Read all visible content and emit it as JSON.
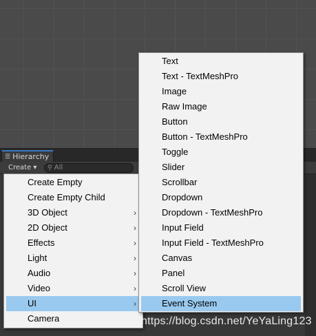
{
  "hierarchy": {
    "tab_label": "Hierarchy",
    "create_label": "Create ▾",
    "search_placeholder": "All"
  },
  "create_menu": {
    "items": [
      {
        "label": "Create Empty",
        "submenu": false
      },
      {
        "label": "Create Empty Child",
        "submenu": false
      },
      {
        "label": "3D Object",
        "submenu": true
      },
      {
        "label": "2D Object",
        "submenu": true
      },
      {
        "label": "Effects",
        "submenu": true
      },
      {
        "label": "Light",
        "submenu": true
      },
      {
        "label": "Audio",
        "submenu": true
      },
      {
        "label": "Video",
        "submenu": true
      },
      {
        "label": "UI",
        "submenu": true,
        "selected": true
      },
      {
        "label": "Camera",
        "submenu": false
      }
    ]
  },
  "ui_submenu": {
    "items": [
      {
        "label": "Text"
      },
      {
        "label": "Text - TextMeshPro"
      },
      {
        "label": "Image"
      },
      {
        "label": "Raw Image"
      },
      {
        "label": "Button"
      },
      {
        "label": "Button - TextMeshPro"
      },
      {
        "label": "Toggle"
      },
      {
        "label": "Slider"
      },
      {
        "label": "Scrollbar"
      },
      {
        "label": "Dropdown"
      },
      {
        "label": "Dropdown - TextMeshPro"
      },
      {
        "label": "Input Field"
      },
      {
        "label": "Input Field - TextMeshPro"
      },
      {
        "label": "Canvas"
      },
      {
        "label": "Panel"
      },
      {
        "label": "Scroll View"
      },
      {
        "label": "Event System",
        "selected": true
      }
    ]
  },
  "watermark": "https://blog.csdn.net/YeYaLing123",
  "colors": {
    "selection": "#99c9ef",
    "menu_bg": "#f2f2f2",
    "editor_bg": "#383838",
    "tab_accent": "#3a78c2"
  },
  "icons": {
    "submenu_arrow": "chevron-right-icon",
    "tab_menu": "hamburger-icon",
    "search": "search-icon"
  }
}
